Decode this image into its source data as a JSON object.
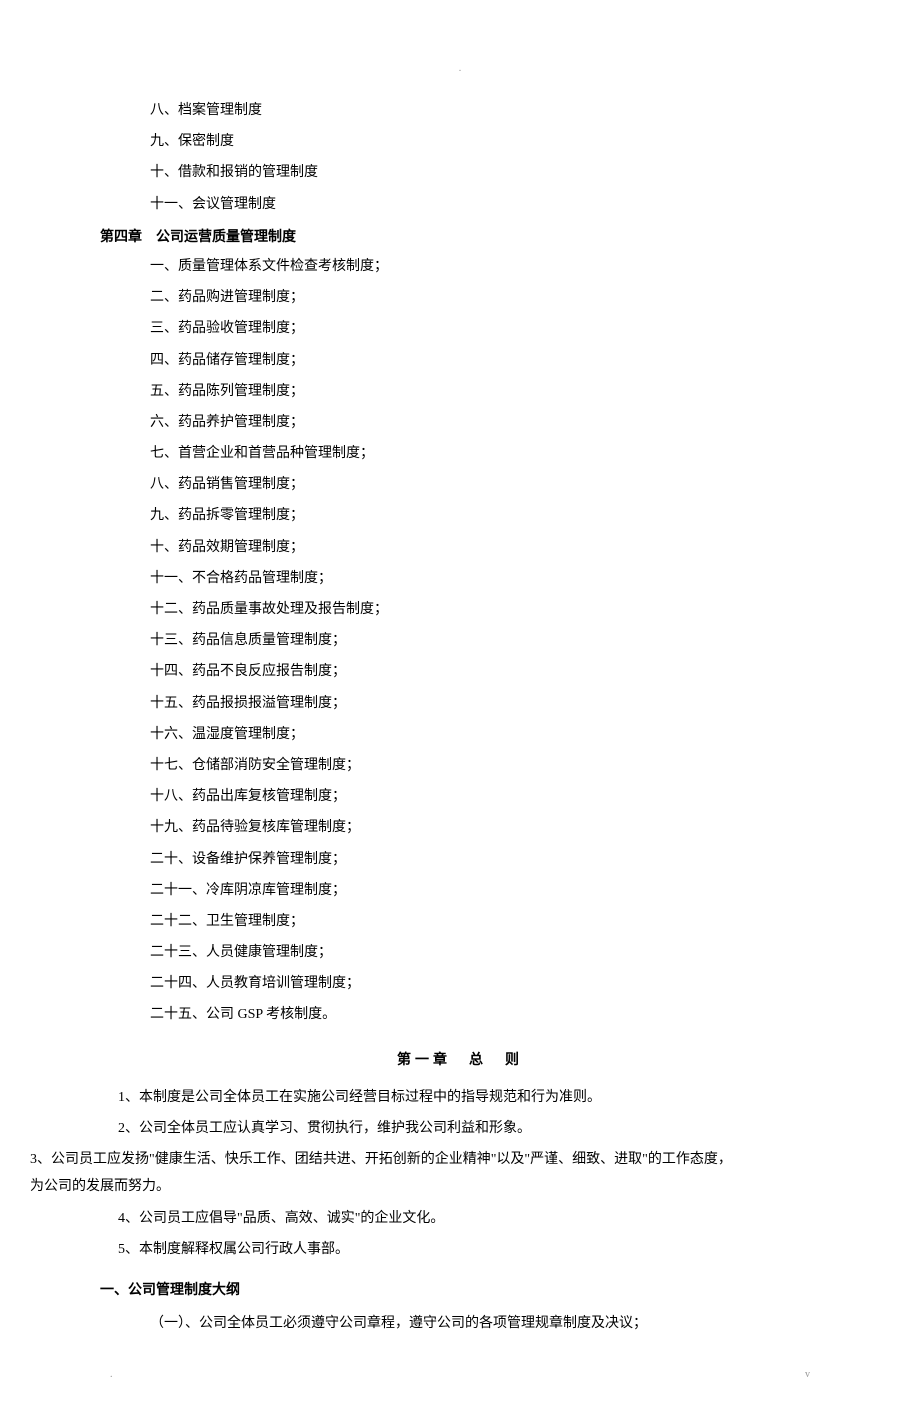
{
  "pre_chapter_items": [
    "八、档案管理制度",
    "九、保密制度",
    "十、借款和报销的管理制度",
    "十一、会议管理制度"
  ],
  "chapter4": {
    "heading": "第四章　公司运营质量管理制度",
    "items": [
      "一、质量管理体系文件检查考核制度；",
      "二、药品购进管理制度；",
      "三、药品验收管理制度；",
      "四、药品储存管理制度；",
      "五、药品陈列管理制度；",
      "六、药品养护管理制度；",
      "七、首营企业和首营品种管理制度；",
      "八、药品销售管理制度；",
      "九、药品拆零管理制度；",
      "十、药品效期管理制度；",
      "十一、不合格药品管理制度；",
      "十二、药品质量事故处理及报告制度；",
      "十三、药品信息质量管理制度；",
      "十四、药品不良反应报告制度；",
      "十五、药品报损报溢管理制度；",
      "十六、温湿度管理制度；",
      "十七、仓储部消防安全管理制度；",
      "十八、药品出库复核管理制度；",
      "十九、药品待验复核库管理制度；",
      "二十、设备维护保养管理制度；",
      "二十一、冷库阴凉库管理制度；",
      "二十二、卫生管理制度；",
      "二十三、人员健康管理制度；",
      "二十四、人员教育培训管理制度；",
      "二十五、公司 GSP 考核制度。"
    ]
  },
  "chapter1": {
    "title": "第一章　总　则",
    "paragraphs": [
      "1、本制度是公司全体员工在实施公司经营目标过程中的指导规范和行为准则。",
      "2、公司全体员工应认真学习、贯彻执行，维护我公司利益和形象。"
    ],
    "paragraph3_lines": [
      "3、公司员工应发扬\"健康生活、快乐工作、团结共进、开拓创新的企业精神\"以及\"严谨、细致、进取\"的工作态度，",
      "为公司的发展而努力。"
    ],
    "paragraphs_after": [
      "4、公司员工应倡导\"品质、高效、诚实\"的企业文化。",
      "5、本制度解释权属公司行政人事部。"
    ]
  },
  "section1": {
    "heading": "一、公司管理制度大纲",
    "items": [
      "（一）、公司全体员工必须遵守公司章程，遵守公司的各项管理规章制度及决议；"
    ]
  },
  "page_marker_top": ".",
  "footer_left": ".",
  "footer_right": "v"
}
